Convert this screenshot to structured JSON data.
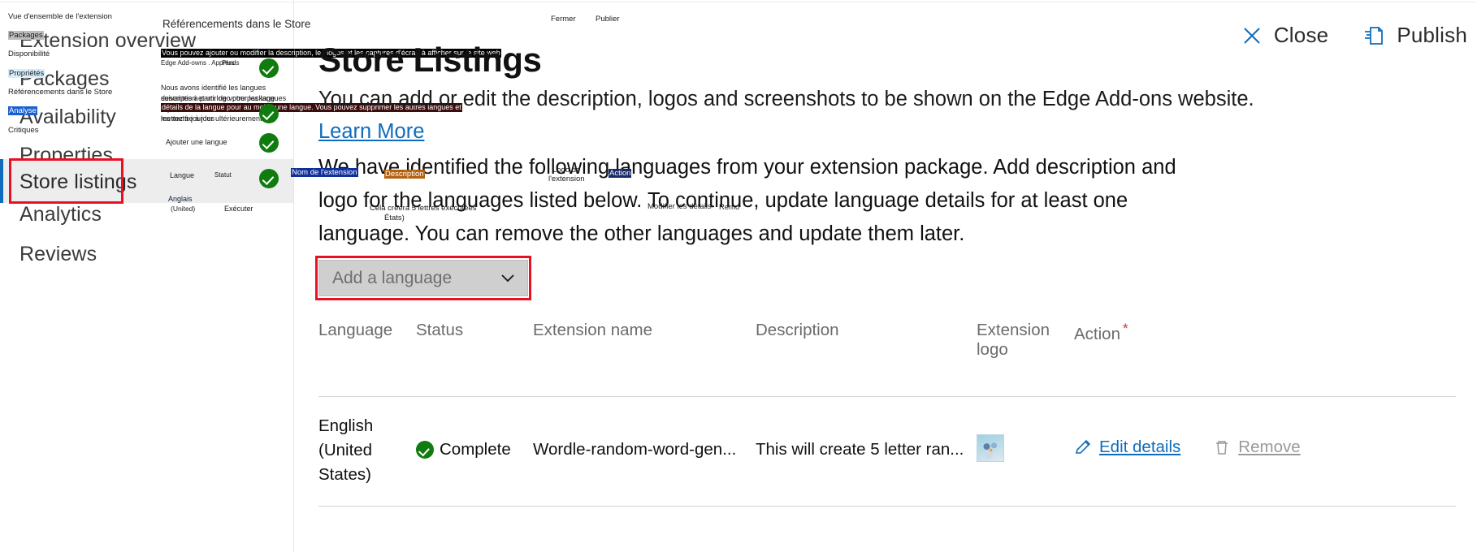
{
  "window": {
    "left_nav_items": [
      {
        "en": "Extension overview",
        "fr": "Vue d'ensemble de l'extension",
        "selected": false
      },
      {
        "en": "Packages",
        "fr": "Disponibilité",
        "selected": false
      },
      {
        "en": "Availability",
        "fr": "Référencements dans le Store",
        "selected": false
      },
      {
        "en": "Properties",
        "fr": "Critiques",
        "selected": false
      },
      {
        "en": "Store listings",
        "fr": "",
        "selected": true
      },
      {
        "en": "Analytics",
        "fr": "",
        "selected": false
      },
      {
        "en": "Reviews",
        "fr": "",
        "selected": false
      }
    ],
    "nav_overlay_chips": [
      {
        "text": "Packages",
        "style": "grey"
      },
      {
        "text": "Propriétés",
        "style": "lblue"
      },
      {
        "text": "Analyse",
        "style": "blue"
      }
    ]
  },
  "middle_panel": {
    "title": "Référencements dans le Store",
    "banner_black": "Vous pouvez ajouter ou modifier la description, les logos et les captures d'écran à afficher sur le site web",
    "small_under_banner": "Edge Add-owns . Apprends",
    "small_more": "Plus",
    "paragraph_line1": "Nous avons identifié les langues suivantes à partir de votre package d'extension. Ajoutez une",
    "paragraph_line2": "description et un logo pour les langues répertoriées ci-dessous. Pour continuer, mettez à jour les",
    "paragraph_line3_banner": "détails de la langue pour au moins une langue. Vous pouvez supprimer les autres langues et",
    "paragraph_line4": "les mettre à jour ultérieurement.",
    "add_language": "Ajouter une langue",
    "col_language": "Langue",
    "col_status": "Statut",
    "row_language_line1": "Anglais",
    "row_language_line2": "(United)",
    "row_status": "Exécuter"
  },
  "command_bar": {
    "close_label": "Close",
    "publish_label": "Publish",
    "fr_close": "Fermer",
    "fr_publish": "Publier"
  },
  "main": {
    "title": "Store Listings",
    "lede_text": "You can add or edit the description, logos and screenshots to be shown on the Edge Add-ons website. ",
    "lede_link": "Learn More",
    "paragraph": "We have identified the following languages from your extension package. Add description and logo for the languages listed below. To continue, update language details for at least one language. You can remove the other languages and update them later.",
    "add_language_placeholder": "Add a language",
    "table": {
      "columns": [
        {
          "label": "Language",
          "required": false
        },
        {
          "label": "Status",
          "required": false
        },
        {
          "label": "Extension name",
          "required": false
        },
        {
          "label": "Description",
          "required": false
        },
        {
          "label": "Extension logo",
          "required": false
        },
        {
          "label": "Action",
          "required": true
        }
      ],
      "required_marker": "*",
      "rows": [
        {
          "language": "English (United States)",
          "status": "Complete",
          "extension_name": "Wordle-random-word-gen...",
          "description": "This will create 5 letter ran...",
          "edit_label": "Edit details",
          "remove_label": "Remove"
        }
      ]
    },
    "overlay_chips": [
      {
        "text": "Nom de l'extension",
        "style": "navy"
      },
      {
        "text": "Description",
        "style": "orange"
      },
      {
        "text": "Logo de",
        "style": "bare"
      },
      {
        "text": "l'extension",
        "style": "bare"
      },
      {
        "text": "Action",
        "style": "slate"
      },
      {
        "text": "Cela créera 5 lettres exécutées",
        "style": "bare"
      },
      {
        "text": "États)",
        "style": "bare"
      },
      {
        "text": "Modifier les détails",
        "style": "bare"
      },
      {
        "text": "Remo",
        "style": "bare"
      }
    ]
  },
  "colors": {
    "accent": "#0f6cbd",
    "highlight_box": "#e81123",
    "success_green": "#107c10",
    "required_red": "#d13438",
    "disabled_grey": "#9a9a9a"
  }
}
